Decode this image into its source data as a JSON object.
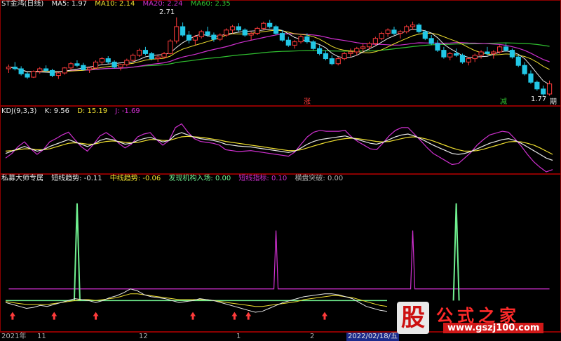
{
  "colors": {
    "background": "#000000",
    "border": "#8b0000",
    "up": "#ff3b3b",
    "down": "#22c7e6",
    "white": "#e8e8e8",
    "yellow": "#f0e030",
    "magenta": "#d030d0",
    "green": "#30c030",
    "lightgreen": "#70f090",
    "gray": "#b0b0b0"
  },
  "price_panel": {
    "title": "ST金鸿(日线)",
    "ma5": "MA5: 1.97",
    "ma10": "MA10: 2.14",
    "ma20": "MA20: 2.24",
    "ma60": "MA60: 2.35",
    "high_label": "2.71",
    "low_label": "1.77",
    "marker_up": "涨",
    "marker_down": "减",
    "marker_right": "期"
  },
  "kdj_panel": {
    "title": "KDJ(9,3,3)",
    "k": "K: 9.56",
    "d": "D: 15.19",
    "j": "J: -1.69"
  },
  "indicator_panel": {
    "title": "私募大师专属",
    "short_trend": "短线趋势: -0.11",
    "mid_trend": "中线趋势: -0.06",
    "inst": "发现机构入场: 0.00",
    "short_idx": "短线指标: 0.10",
    "breakout": "横盘突破: 0.00"
  },
  "time_axis": {
    "labels": [
      "2021年",
      "11",
      "12",
      "1",
      "2"
    ],
    "current": "2022/02/18/五"
  },
  "watermark": {
    "logo_char": "股",
    "text": "公式之家",
    "url": "www.gszj100.com"
  },
  "chart_data": [
    {
      "type": "candlestick",
      "title": "ST金鸿(日线)",
      "x_start": "2021年",
      "x_end": "2022/02/18/五",
      "ylim": [
        1.7,
        2.8
      ],
      "ohlc": [
        [
          2.1,
          2.15,
          2.05,
          2.12
        ],
        [
          2.12,
          2.18,
          2.08,
          2.1
        ],
        [
          2.1,
          2.13,
          2.02,
          2.04
        ],
        [
          2.04,
          2.06,
          1.98,
          2.0
        ],
        [
          2.0,
          2.08,
          1.99,
          2.07
        ],
        [
          2.07,
          2.12,
          2.04,
          2.1
        ],
        [
          2.1,
          2.14,
          2.06,
          2.08
        ],
        [
          2.08,
          2.1,
          2.0,
          2.02
        ],
        [
          2.02,
          2.06,
          1.98,
          2.05
        ],
        [
          2.05,
          2.12,
          2.03,
          2.11
        ],
        [
          2.11,
          2.18,
          2.09,
          2.16
        ],
        [
          2.16,
          2.2,
          2.12,
          2.14
        ],
        [
          2.14,
          2.17,
          2.08,
          2.09
        ],
        [
          2.09,
          2.12,
          2.05,
          2.11
        ],
        [
          2.11,
          2.2,
          2.1,
          2.18
        ],
        [
          2.18,
          2.24,
          2.15,
          2.22
        ],
        [
          2.22,
          2.25,
          2.16,
          2.18
        ],
        [
          2.18,
          2.2,
          2.1,
          2.12
        ],
        [
          2.12,
          2.16,
          2.08,
          2.15
        ],
        [
          2.15,
          2.22,
          2.13,
          2.2
        ],
        [
          2.2,
          2.28,
          2.18,
          2.26
        ],
        [
          2.26,
          2.34,
          2.24,
          2.32
        ],
        [
          2.32,
          2.36,
          2.26,
          2.28
        ],
        [
          2.28,
          2.3,
          2.2,
          2.22
        ],
        [
          2.22,
          2.26,
          2.18,
          2.24
        ],
        [
          2.24,
          2.3,
          2.22,
          2.28
        ],
        [
          2.28,
          2.45,
          2.27,
          2.43
        ],
        [
          2.43,
          2.71,
          2.4,
          2.6
        ],
        [
          2.6,
          2.65,
          2.48,
          2.5
        ],
        [
          2.5,
          2.55,
          2.4,
          2.44
        ],
        [
          2.44,
          2.5,
          2.38,
          2.48
        ],
        [
          2.48,
          2.56,
          2.46,
          2.54
        ],
        [
          2.54,
          2.6,
          2.48,
          2.5
        ],
        [
          2.5,
          2.53,
          2.42,
          2.45
        ],
        [
          2.45,
          2.52,
          2.43,
          2.5
        ],
        [
          2.5,
          2.58,
          2.48,
          2.56
        ],
        [
          2.56,
          2.62,
          2.52,
          2.6
        ],
        [
          2.6,
          2.64,
          2.54,
          2.56
        ],
        [
          2.56,
          2.58,
          2.48,
          2.5
        ],
        [
          2.5,
          2.54,
          2.44,
          2.52
        ],
        [
          2.52,
          2.6,
          2.5,
          2.58
        ],
        [
          2.58,
          2.66,
          2.56,
          2.64
        ],
        [
          2.64,
          2.68,
          2.58,
          2.6
        ],
        [
          2.6,
          2.62,
          2.5,
          2.52
        ],
        [
          2.52,
          2.56,
          2.42,
          2.44
        ],
        [
          2.44,
          2.48,
          2.36,
          2.38
        ],
        [
          2.38,
          2.44,
          2.34,
          2.42
        ],
        [
          2.42,
          2.5,
          2.4,
          2.48
        ],
        [
          2.48,
          2.52,
          2.4,
          2.42
        ],
        [
          2.42,
          2.44,
          2.32,
          2.34
        ],
        [
          2.34,
          2.38,
          2.26,
          2.28
        ],
        [
          2.28,
          2.32,
          2.2,
          2.22
        ],
        [
          2.22,
          2.26,
          2.14,
          2.16
        ],
        [
          2.16,
          2.24,
          2.14,
          2.22
        ],
        [
          2.22,
          2.3,
          2.2,
          2.28
        ],
        [
          2.28,
          2.34,
          2.24,
          2.3
        ],
        [
          2.3,
          2.36,
          2.26,
          2.34
        ],
        [
          2.34,
          2.4,
          2.3,
          2.36
        ],
        [
          2.36,
          2.42,
          2.32,
          2.4
        ],
        [
          2.4,
          2.48,
          2.38,
          2.46
        ],
        [
          2.46,
          2.54,
          2.44,
          2.52
        ],
        [
          2.52,
          2.58,
          2.48,
          2.56
        ],
        [
          2.56,
          2.6,
          2.5,
          2.52
        ],
        [
          2.52,
          2.56,
          2.46,
          2.54
        ],
        [
          2.54,
          2.62,
          2.52,
          2.6
        ],
        [
          2.6,
          2.66,
          2.56,
          2.62
        ],
        [
          2.62,
          2.64,
          2.52,
          2.54
        ],
        [
          2.54,
          2.56,
          2.44,
          2.46
        ],
        [
          2.46,
          2.5,
          2.38,
          2.4
        ],
        [
          2.4,
          2.44,
          2.3,
          2.32
        ],
        [
          2.32,
          2.36,
          2.22,
          2.24
        ],
        [
          2.24,
          2.3,
          2.2,
          2.28
        ],
        [
          2.28,
          2.34,
          2.24,
          2.26
        ],
        [
          2.26,
          2.28,
          2.16,
          2.18
        ],
        [
          2.18,
          2.24,
          2.14,
          2.22
        ],
        [
          2.22,
          2.28,
          2.18,
          2.26
        ],
        [
          2.26,
          2.32,
          2.22,
          2.3
        ],
        [
          2.3,
          2.36,
          2.26,
          2.28
        ],
        [
          2.28,
          2.32,
          2.22,
          2.3
        ],
        [
          2.3,
          2.38,
          2.28,
          2.36
        ],
        [
          2.36,
          2.4,
          2.3,
          2.32
        ],
        [
          2.32,
          2.34,
          2.22,
          2.24
        ],
        [
          2.24,
          2.26,
          2.12,
          2.14
        ],
        [
          2.14,
          2.18,
          2.02,
          2.04
        ],
        [
          2.04,
          2.08,
          1.92,
          1.94
        ],
        [
          1.94,
          1.96,
          1.84,
          1.86
        ],
        [
          1.86,
          1.9,
          1.77,
          1.8
        ],
        [
          1.8,
          1.96,
          1.78,
          1.92
        ]
      ]
    },
    {
      "type": "line",
      "title": "KDJ(9,3,3)",
      "ylim": [
        -10,
        110
      ],
      "series": [
        {
          "name": "K",
          "color": "#e8e8e8",
          "values": [
            30,
            35,
            40,
            45,
            40,
            35,
            38,
            45,
            50,
            55,
            60,
            55,
            50,
            45,
            50,
            58,
            62,
            60,
            55,
            50,
            52,
            58,
            62,
            65,
            60,
            55,
            58,
            70,
            75,
            70,
            65,
            62,
            60,
            58,
            55,
            50,
            48,
            46,
            45,
            44,
            42,
            40,
            38,
            36,
            34,
            32,
            35,
            42,
            50,
            56,
            60,
            62,
            64,
            66,
            68,
            64,
            60,
            56,
            52,
            50,
            54,
            60,
            66,
            70,
            72,
            68,
            62,
            55,
            48,
            42,
            36,
            30,
            28,
            30,
            34,
            40,
            46,
            52,
            56,
            60,
            62,
            58,
            52,
            44,
            36,
            28,
            20,
            15
          ]
        },
        {
          "name": "D",
          "color": "#f0e030",
          "values": [
            35,
            36,
            38,
            40,
            40,
            38,
            38,
            40,
            44,
            48,
            52,
            53,
            52,
            50,
            50,
            53,
            56,
            57,
            56,
            54,
            53,
            54,
            57,
            60,
            60,
            58,
            58,
            62,
            66,
            67,
            66,
            65,
            63,
            61,
            59,
            56,
            54,
            52,
            50,
            48,
            46,
            44,
            42,
            40,
            38,
            36,
            36,
            38,
            42,
            46,
            50,
            54,
            57,
            60,
            62,
            63,
            62,
            60,
            58,
            56,
            55,
            56,
            59,
            62,
            65,
            66,
            64,
            61,
            57,
            52,
            47,
            42,
            38,
            35,
            35,
            36,
            39,
            43,
            47,
            51,
            55,
            56,
            55,
            52,
            48,
            42,
            35,
            28
          ]
        },
        {
          "name": "J",
          "color": "#d030d0",
          "values": [
            20,
            30,
            45,
            55,
            40,
            28,
            38,
            55,
            62,
            70,
            76,
            60,
            45,
            35,
            50,
            68,
            75,
            66,
            52,
            42,
            50,
            66,
            72,
            75,
            60,
            48,
            58,
            86,
            94,
            76,
            62,
            56,
            54,
            52,
            48,
            38,
            36,
            34,
            35,
            36,
            34,
            32,
            30,
            28,
            26,
            24,
            33,
            50,
            66,
            76,
            80,
            78,
            78,
            78,
            80,
            66,
            56,
            48,
            40,
            38,
            52,
            68,
            80,
            86,
            86,
            72,
            58,
            43,
            30,
            22,
            14,
            6,
            8,
            20,
            32,
            48,
            60,
            70,
            74,
            78,
            76,
            62,
            46,
            28,
            12,
            0,
            -10,
            -5
          ]
        }
      ]
    },
    {
      "type": "line",
      "title": "私募大师专属",
      "ylim": [
        -0.3,
        1.2
      ],
      "spikes": [
        {
          "series": "发现机构入场",
          "color": "#70f090",
          "at_index": 11,
          "value": 1.0
        },
        {
          "series": "短线指标",
          "color": "#d030d0",
          "at_index": 43,
          "value": 0.72
        },
        {
          "series": "短线指标",
          "color": "#d030d0",
          "at_index": 65,
          "value": 0.72
        },
        {
          "series": "发现机构入场",
          "color": "#70f090",
          "at_index": 72,
          "value": 1.0
        }
      ],
      "series": [
        {
          "name": "短线趋势",
          "color": "#e8e8e8",
          "values": [
            -0.02,
            -0.04,
            -0.06,
            -0.08,
            -0.07,
            -0.05,
            -0.06,
            -0.04,
            -0.02,
            0.0,
            0.02,
            0.01,
            0.0,
            -0.02,
            0.0,
            0.03,
            0.05,
            0.08,
            0.12,
            0.1,
            0.06,
            0.04,
            0.03,
            0.02,
            0.0,
            -0.02,
            -0.01,
            0.0,
            0.02,
            0.01,
            0.0,
            -0.02,
            -0.04,
            -0.06,
            -0.08,
            -0.1,
            -0.12,
            -0.11,
            -0.08,
            -0.05,
            -0.02,
            0.0,
            0.02,
            0.04,
            0.05,
            0.06,
            0.07,
            0.07,
            0.06,
            0.04,
            0.02,
            -0.02,
            -0.06,
            -0.08,
            -0.1,
            -0.11
          ]
        },
        {
          "name": "中线趋势",
          "color": "#f0e030",
          "values": [
            -0.01,
            -0.02,
            -0.03,
            -0.04,
            -0.04,
            -0.04,
            -0.04,
            -0.03,
            -0.02,
            -0.01,
            0.0,
            0.01,
            0.01,
            0.0,
            0.01,
            0.02,
            0.03,
            0.05,
            0.07,
            0.07,
            0.06,
            0.05,
            0.04,
            0.03,
            0.02,
            0.01,
            0.01,
            0.01,
            0.01,
            0.01,
            0.0,
            -0.01,
            -0.02,
            -0.03,
            -0.04,
            -0.05,
            -0.06,
            -0.06,
            -0.05,
            -0.04,
            -0.03,
            -0.02,
            -0.01,
            0.01,
            0.02,
            0.03,
            0.04,
            0.05,
            0.05,
            0.04,
            0.03,
            0.01,
            -0.01,
            -0.03,
            -0.05,
            -0.06
          ]
        },
        {
          "name": "横盘突破",
          "color": "#70f090",
          "values": [
            0,
            0,
            0,
            0,
            0,
            0,
            0,
            0,
            0,
            0,
            0,
            0,
            0,
            0,
            0,
            0,
            0,
            0,
            0,
            0,
            0,
            0,
            0,
            0,
            0,
            0,
            0,
            0,
            0,
            0,
            0,
            0,
            0,
            0,
            0,
            0,
            0,
            0,
            0,
            0,
            0,
            0,
            0,
            0,
            0,
            0,
            0,
            0,
            0,
            0,
            0,
            0,
            0,
            0,
            0,
            0
          ]
        }
      ],
      "buy_arrows_at_index": [
        1,
        7,
        13,
        27,
        33,
        35,
        46
      ]
    }
  ]
}
